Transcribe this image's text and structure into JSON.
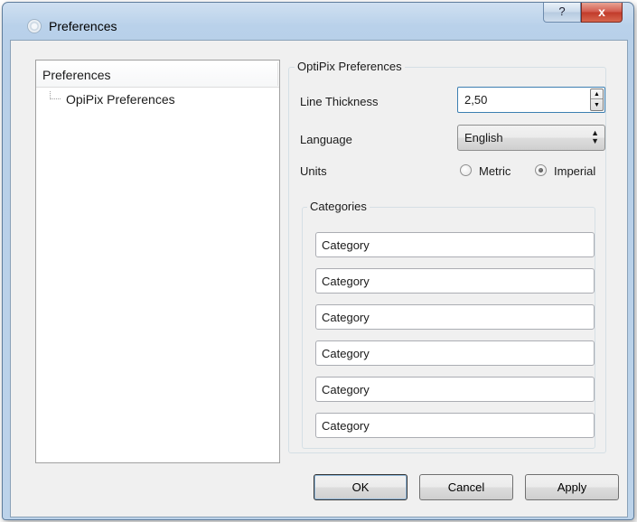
{
  "window": {
    "title": "Preferences",
    "help_label": "?",
    "close_label": "x"
  },
  "tree": {
    "header": "Preferences",
    "items": [
      {
        "label": "OpiPix Preferences"
      }
    ]
  },
  "options": {
    "group_title": "OptiPix Preferences",
    "line_thickness": {
      "label": "Line Thickness",
      "value": "2,50"
    },
    "language": {
      "label": "Language",
      "value": "English"
    },
    "units": {
      "label": "Units",
      "options": [
        "Metric",
        "Imperial"
      ],
      "selected": "Imperial"
    }
  },
  "categories": {
    "title": "Categories",
    "items": [
      "Category",
      "Category",
      "Category",
      "Category",
      "Category",
      "Category"
    ]
  },
  "buttons": {
    "ok": "OK",
    "cancel": "Cancel",
    "apply": "Apply"
  },
  "colors": {
    "title_bar": "#b9d1ea",
    "close_button": "#c13a2a",
    "dialog_background": "#f0f0f0",
    "focus_border": "#3c7fb1"
  }
}
